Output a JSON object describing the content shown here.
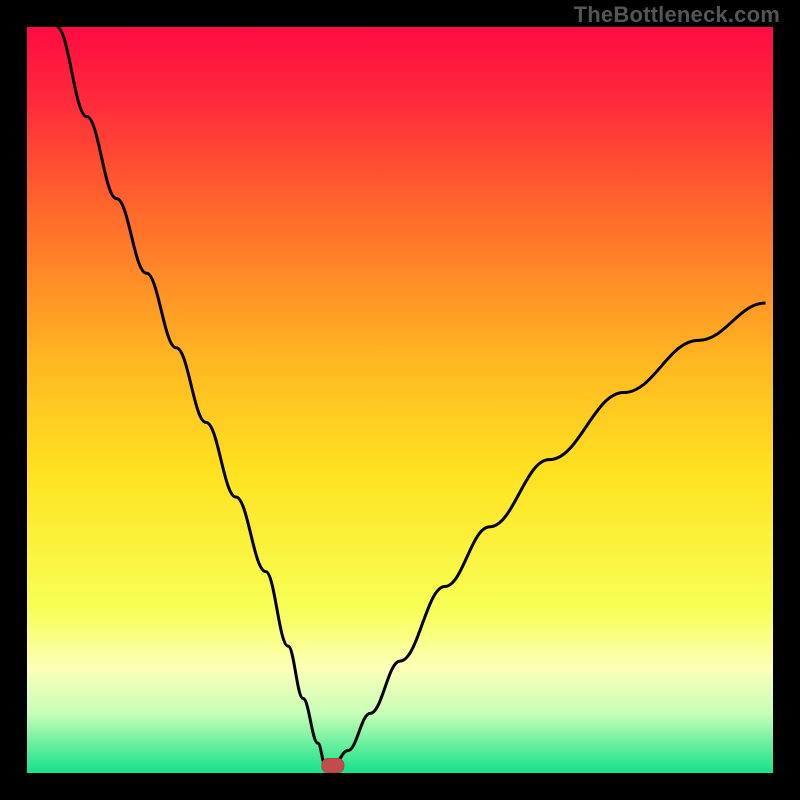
{
  "watermark": "TheBottleneck.com",
  "colors": {
    "frame": "#000000",
    "curve": "#000000",
    "marker_fill": "#c24b4b",
    "marker_stroke": "#b0433f",
    "gradient_stops": [
      {
        "offset": 0.0,
        "color": "#ff0b42"
      },
      {
        "offset": 0.1,
        "color": "#ff2a3b"
      },
      {
        "offset": 0.25,
        "color": "#ff6a2b"
      },
      {
        "offset": 0.45,
        "color": "#ffb822"
      },
      {
        "offset": 0.6,
        "color": "#ffe321"
      },
      {
        "offset": 0.78,
        "color": "#f7ff56"
      },
      {
        "offset": 0.86,
        "color": "#fdffb8"
      },
      {
        "offset": 0.92,
        "color": "#c8ffb8"
      },
      {
        "offset": 0.96,
        "color": "#6bf09f"
      },
      {
        "offset": 1.0,
        "color": "#14e28a"
      }
    ]
  },
  "chart_data": {
    "type": "line",
    "title": "",
    "xlabel": "",
    "ylabel": "",
    "xlim": [
      0,
      100
    ],
    "ylim": [
      0,
      100
    ],
    "series": [
      {
        "name": "bottleneck-curve",
        "x": [
          4,
          8,
          12,
          16,
          20,
          24,
          28,
          32,
          35,
          37,
          39,
          40,
          41,
          43,
          46,
          50,
          56,
          62,
          70,
          80,
          90,
          99
        ],
        "y": [
          100,
          88,
          77,
          67,
          57,
          47,
          37,
          27,
          17,
          10,
          4,
          1,
          1,
          3,
          8,
          15,
          25,
          33,
          42,
          51,
          58,
          63
        ]
      }
    ],
    "marker": {
      "x": 41,
      "y": 1
    },
    "notes": "Vertical gradient background from red (top) through orange/yellow to green (bottom). Single black V-shaped curve with minimum near x≈41. Small rounded red marker at the curve's minimum."
  }
}
